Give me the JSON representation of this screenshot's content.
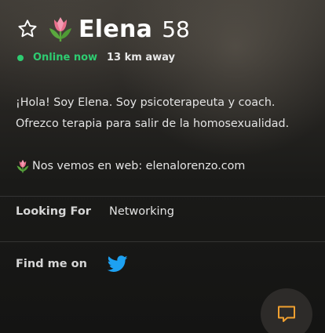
{
  "profile": {
    "name": "Elena",
    "age": "58",
    "status": "Online now",
    "distance": "13 km away"
  },
  "bio": {
    "line1": "¡Hola! Soy Elena. Soy psicoterapeuta y coach.",
    "line2": "Ofrezco terapia para salir de la homosexualidad.",
    "web_text": "Nos vemos en web:  elenalorenzo.com"
  },
  "details": {
    "looking_for_label": "Looking For",
    "looking_for_value": "Networking",
    "find_me_label": "Find me on"
  },
  "icons": {
    "favorite": "star-outline-icon",
    "emoji": "tulip-icon",
    "social": "twitter-icon",
    "chat": "chat-icon"
  },
  "colors": {
    "online": "#2ecc71",
    "twitter": "#1da1f2",
    "chat_accent": "#f0a030",
    "tulip": "#e8708c"
  }
}
